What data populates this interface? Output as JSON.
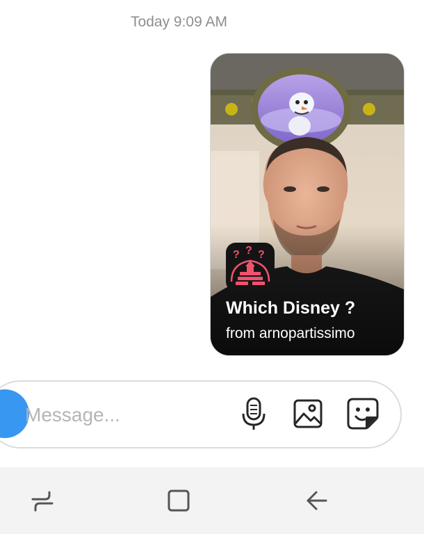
{
  "thread": {
    "timestamp": "Today 9:09 AM"
  },
  "shared_card": {
    "title": "Which Disney ?",
    "subtitle": "from arnopartissimo",
    "app_icon": "castle-question-icon",
    "preview": "face-filter-preview"
  },
  "composer": {
    "placeholder": "Message...",
    "value": "",
    "icons": [
      "camera-icon",
      "microphone-icon",
      "gallery-icon",
      "sticker-icon"
    ],
    "accent_color": "#3897f0"
  },
  "system_nav": {
    "icons": [
      "recent-apps-icon",
      "home-icon",
      "back-icon"
    ]
  }
}
